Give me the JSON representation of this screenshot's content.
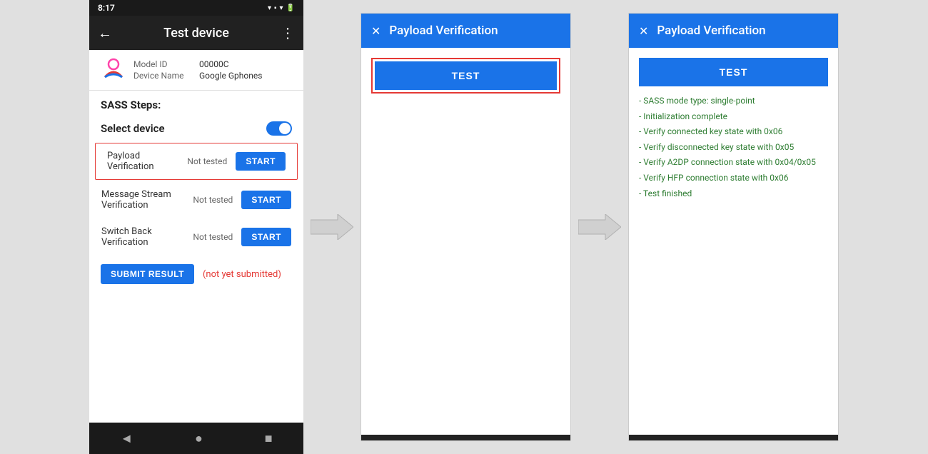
{
  "statusBar": {
    "time": "8:17",
    "icons": "▾ ⊙ ✦ ☼ •",
    "rightIcons": "▾ 🔋"
  },
  "appBar": {
    "backLabel": "←",
    "title": "Test device",
    "menuIcon": "⋮"
  },
  "deviceInfo": {
    "modelLabel": "Model ID",
    "modelValue": "00000C",
    "deviceNameLabel": "Device Name",
    "deviceNameValue": "Google Gphones"
  },
  "sassSteps": {
    "title": "SASS Steps:",
    "selectDevice": "Select device"
  },
  "testRows": [
    {
      "name": "Payload Verification",
      "status": "Not tested",
      "startLabel": "START",
      "highlighted": true
    },
    {
      "name": "Message Stream Verification",
      "status": "Not tested",
      "startLabel": "START",
      "highlighted": false
    },
    {
      "name": "Switch Back Verification",
      "status": "Not tested",
      "startLabel": "START",
      "highlighted": false
    }
  ],
  "submitRow": {
    "buttonLabel": "SUBMIT RESULT",
    "statusText": "(not yet submitted)"
  },
  "bottomNav": {
    "back": "◄",
    "home": "●",
    "recent": "■"
  },
  "dialog1": {
    "closeLabel": "✕",
    "title": "Payload Verification",
    "testButtonLabel": "TEST",
    "showBorder": true
  },
  "dialog2": {
    "closeLabel": "✕",
    "title": "Payload Verification",
    "testButtonLabel": "TEST",
    "showBorder": false,
    "results": [
      "- SASS mode type: single-point",
      "- Initialization complete",
      "- Verify connected key state with 0x06",
      "- Verify disconnected key state with 0x05",
      "- Verify A2DP connection state with 0x04/0x05",
      "- Verify HFP connection state with 0x06",
      "- Test finished"
    ]
  }
}
